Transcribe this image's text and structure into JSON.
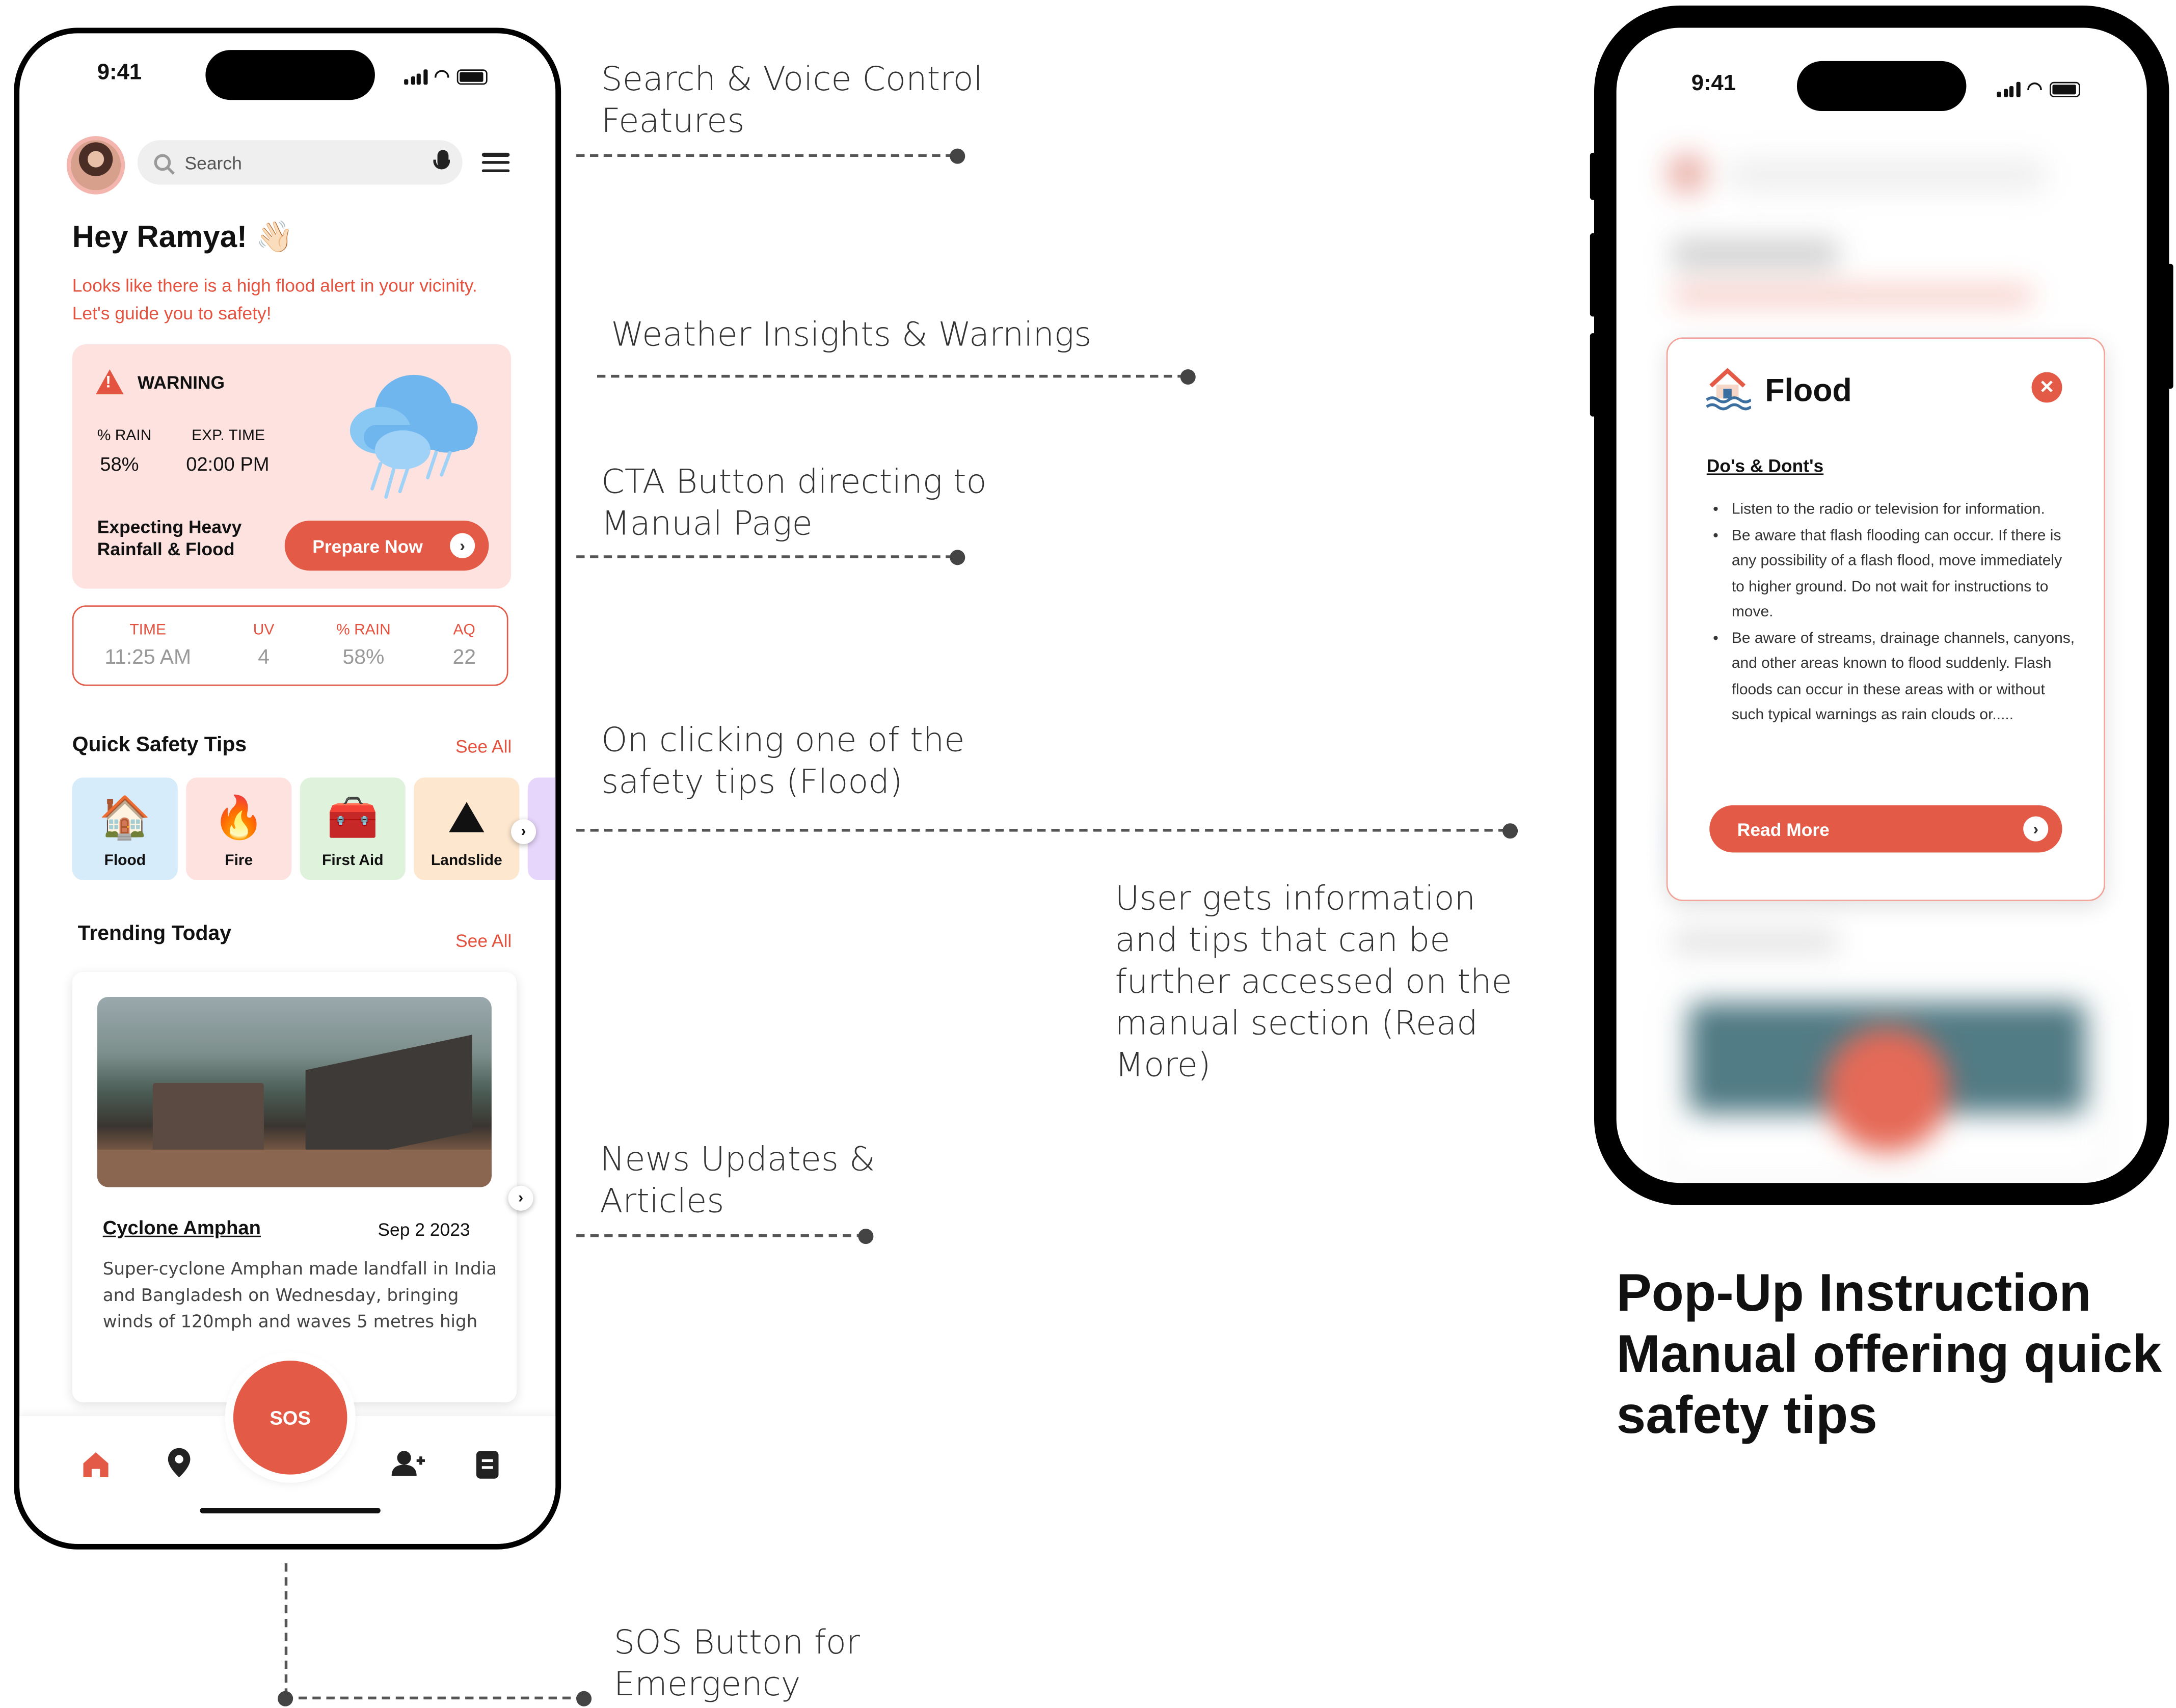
{
  "home": {
    "status_time": "9:41",
    "search_placeholder": "Search",
    "greeting": "Hey Ramya! 👋🏻",
    "alert_message": "Looks like there is a high flood alert in your vicinity. Let's guide you to safety!",
    "warning": {
      "label": "WARNING",
      "rain_label": "% RAIN",
      "rain_value": "58%",
      "exp_label": "EXP. TIME",
      "exp_value": "02:00 PM",
      "expecting_line1": "Expecting Heavy",
      "expecting_line2": "Rainfall & Flood",
      "cta_label": "Prepare Now"
    },
    "stats": [
      {
        "label": "TIME",
        "value": "11:25 AM"
      },
      {
        "label": "UV",
        "value": "4"
      },
      {
        "label": "% RAIN",
        "value": "58%"
      },
      {
        "label": "AQ",
        "value": "22"
      }
    ],
    "quick_tips": {
      "title": "Quick Safety Tips",
      "see_all": "See All",
      "items": [
        {
          "label": "Flood",
          "icon": "house-flood-icon",
          "bg": "#d6ecfa"
        },
        {
          "label": "Fire",
          "icon": "fire-icon",
          "bg": "#fde2df"
        },
        {
          "label": "First Aid",
          "icon": "first-aid-kit-icon",
          "bg": "#dff3dc"
        },
        {
          "label": "Landslide",
          "icon": "landslide-icon",
          "bg": "#fde7cf"
        }
      ]
    },
    "trending": {
      "title": "Trending Today",
      "see_all": "See All",
      "article_title": "Cyclone Amphan",
      "article_date": "Sep 2 2023",
      "article_body": "Super-cyclone Amphan made landfall in India and Bangladesh on Wednesday, bringing winds of 120mph and waves 5 metres high"
    },
    "sos_label": "SOS"
  },
  "popup_phone": {
    "status_time": "9:41",
    "title": "Flood",
    "section_title": "Do's & Dont's",
    "bullets": [
      "Listen to the radio or television for information.",
      "Be aware that flash flooding can occur. If there is any possibility of a flash flood, move immediately to higher ground. Do not wait for instructions to move.",
      "Be aware of streams, drainage channels, canyons, and other areas known to flood suddenly. Flash floods can occur in these areas with or without such typical warnings as rain clouds or....."
    ],
    "read_more": "Read More"
  },
  "annotations": {
    "search_voice": "Search & Voice Control Features",
    "weather": "Weather Insights & Warnings",
    "cta": "CTA Button directing to Manual Page",
    "safety_tip": "On clicking one of the safety tips (Flood)",
    "user_info": "User gets information and tips that can be further accessed on the manual section (Read More)",
    "news": "News Updates & Articles",
    "sos": "SOS Button for Emergency"
  },
  "headline": "Pop-Up Instruction Manual offering quick safety tips",
  "colors": {
    "accent": "#e35a46",
    "warning_bg": "#fde2df"
  }
}
